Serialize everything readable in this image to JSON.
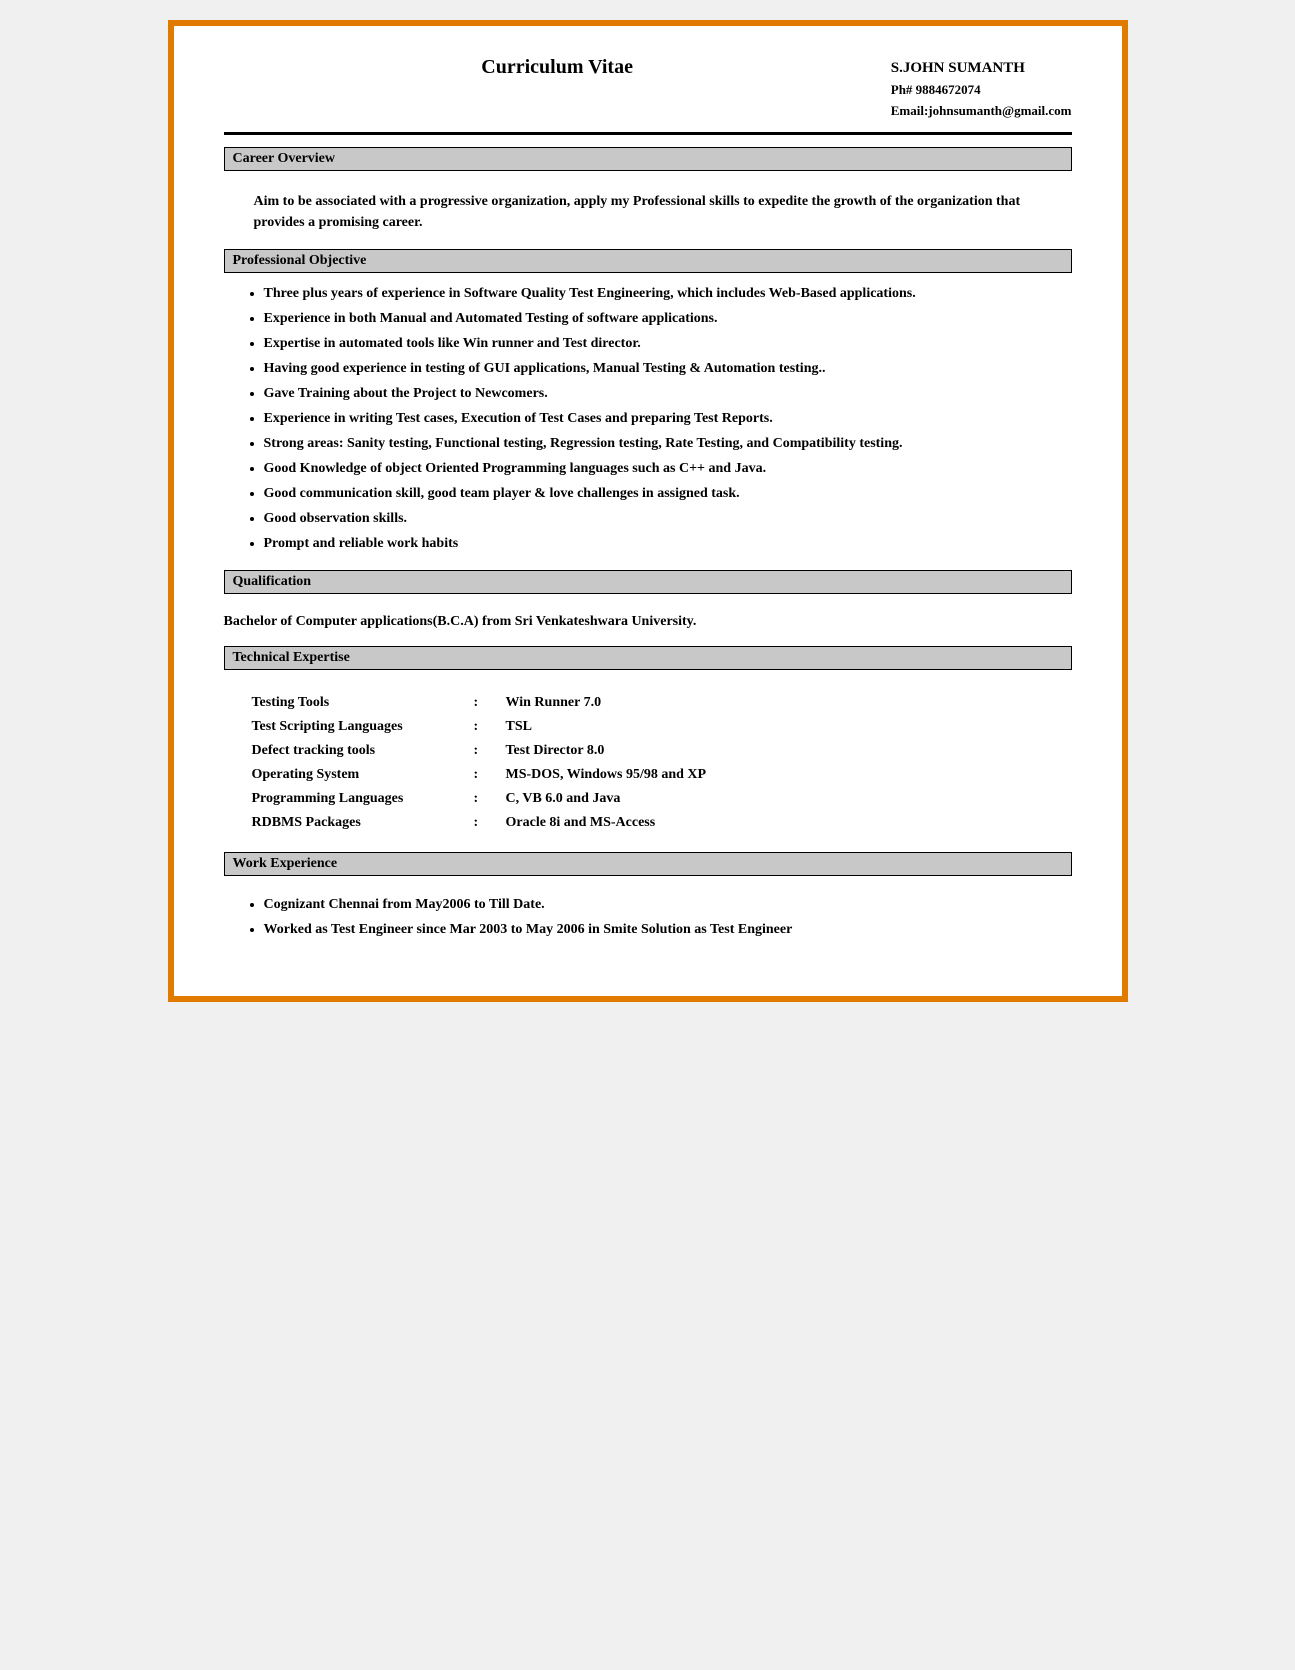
{
  "resume": {
    "header": {
      "title": "Curriculum Vitae",
      "name": "S.JOHN SUMANTH",
      "phone": "Ph# 9884672074",
      "email": "Email:johnsumanth@gmail.com"
    },
    "sections": {
      "career_overview": {
        "label": "Career Overview",
        "text": "Aim to be associated with a progressive organization, apply my Professional skills to expedite the growth of the organization that provides a promising career."
      },
      "professional_objective": {
        "label": "Professional Objective",
        "bullets": [
          "Three plus years of experience in Software Quality Test Engineering, which includes Web-Based applications.",
          "Experience in both Manual and Automated Testing of software applications.",
          "Expertise in automated tools like Win runner and Test director.",
          "Having good experience in testing of GUI applications, Manual Testing & Automation testing..",
          "Gave Training about the Project to Newcomers.",
          "Experience in writing Test cases, Execution of Test Cases and preparing Test Reports.",
          "Strong areas: Sanity testing, Functional testing, Regression testing, Rate Testing, and Compatibility testing.",
          "Good Knowledge of object Oriented Programming languages such as C++ and Java.",
          "Good communication skill, good team player & love challenges in assigned task.",
          "Good observation skills.",
          "Prompt and reliable work habits"
        ]
      },
      "qualification": {
        "label": "Qualification",
        "text": "Bachelor of Computer applications(B.C.A)  from Sri Venkateshwara University."
      },
      "technical_expertise": {
        "label": "Technical Expertise",
        "rows": [
          {
            "label": "Testing Tools",
            "separator": ":",
            "value": "Win Runner 7.0"
          },
          {
            "label": "Test Scripting Languages",
            "separator": ":",
            "value": "TSL"
          },
          {
            "label": "Defect tracking tools",
            "separator": ":",
            "value": "Test Director 8.0"
          },
          {
            "label": "Operating System",
            "separator": ":",
            "value": "MS-DOS, Windows 95/98 and XP"
          },
          {
            "label": "Programming Languages",
            "separator": ":",
            "value": "C, VB 6.0 and Java"
          },
          {
            "label": "RDBMS Packages",
            "separator": ":",
            "value": "Oracle 8i and MS-Access"
          }
        ]
      },
      "work_experience": {
        "label": "Work Experience",
        "bullets": [
          "Cognizant Chennai from May2006 to Till Date.",
          "Worked as Test Engineer since Mar 2003 to May 2006 in Smite Solution as Test Engineer"
        ]
      }
    }
  }
}
